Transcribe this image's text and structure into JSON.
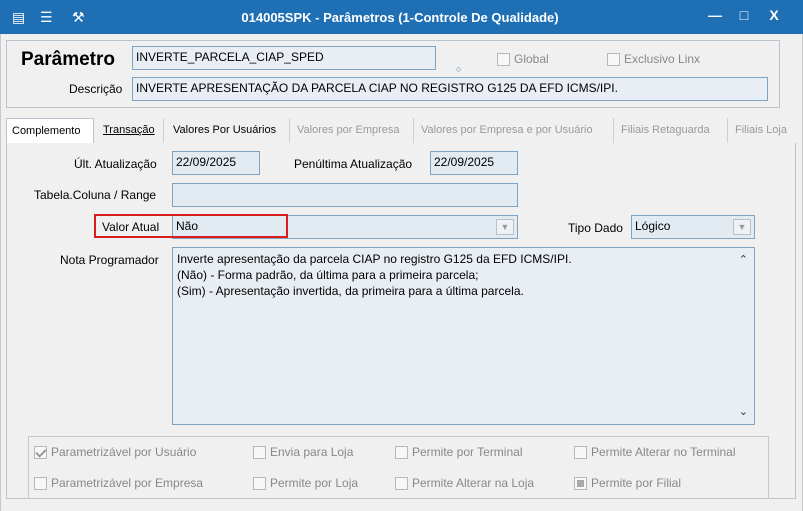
{
  "window": {
    "title": "014005SPK - Parâmetros (1-Controle De Qualidade)",
    "controls": {
      "minimize": "—",
      "maximize": "□",
      "close": "X"
    },
    "icons": [
      "menu-icon",
      "settings-icon",
      "tools-icon"
    ]
  },
  "header": {
    "parametro_label": "Parâmetro",
    "parametro_value": "INVERTE_PARCELA_CIAP_SPED",
    "global_label": "Global",
    "exclusivo_label": "Exclusivo Linx",
    "descricao_label": "Descrição",
    "descricao_value": "INVERTE APRESENTAÇÃO DA PARCELA CIAP NO REGISTRO G125 DA EFD ICMS/IPI."
  },
  "tabs": [
    {
      "label": "Complemento",
      "active": true,
      "disabled": false
    },
    {
      "label": "Transação",
      "active": false,
      "disabled": false
    },
    {
      "label": "Valores Por Usuários",
      "active": false,
      "disabled": false
    },
    {
      "label": "Valores por Empresa",
      "active": false,
      "disabled": true
    },
    {
      "label": "Valores por Empresa e por Usuário",
      "active": false,
      "disabled": true
    },
    {
      "label": "Filiais Retaguarda",
      "active": false,
      "disabled": true
    },
    {
      "label": "Filiais Loja",
      "active": false,
      "disabled": true
    }
  ],
  "complemento": {
    "ult_atualizacao_label": "Últ. Atualização",
    "ult_atualizacao_value": "22/09/2025",
    "penultima_label": "Penúltima Atualização",
    "penultima_value": "22/09/2025",
    "tabela_label": "Tabela.Coluna / Range",
    "tabela_value": "",
    "valor_atual_label": "Valor Atual",
    "valor_atual_value": "Não",
    "tipo_dado_label": "Tipo Dado",
    "tipo_dado_value": "Lógico",
    "nota_label": "Nota Programador",
    "nota_lines": [
      "Inverte apresentação da parcela CIAP no registro G125 da EFD ICMS/IPI.",
      "(Não) - Forma padrão, da última para a primeira parcela;",
      "(Sim) - Apresentação invertida, da primeira para a última parcela."
    ]
  },
  "options": [
    {
      "label": "Parametrizável por Usuário",
      "state": "checked"
    },
    {
      "label": "Envia para Loja",
      "state": "unchecked"
    },
    {
      "label": "Permite por Terminal",
      "state": "unchecked"
    },
    {
      "label": "Permite Alterar no Terminal",
      "state": "unchecked"
    },
    {
      "label": "Parametrizável por Empresa",
      "state": "unchecked"
    },
    {
      "label": "Permite por Loja",
      "state": "unchecked"
    },
    {
      "label": "Permite Alterar na Loja",
      "state": "unchecked"
    },
    {
      "label": "Permite por Filial",
      "state": "indeterminate"
    }
  ],
  "colors": {
    "titlebar": "#1f6fb5",
    "highlight": "#d81e1e"
  }
}
